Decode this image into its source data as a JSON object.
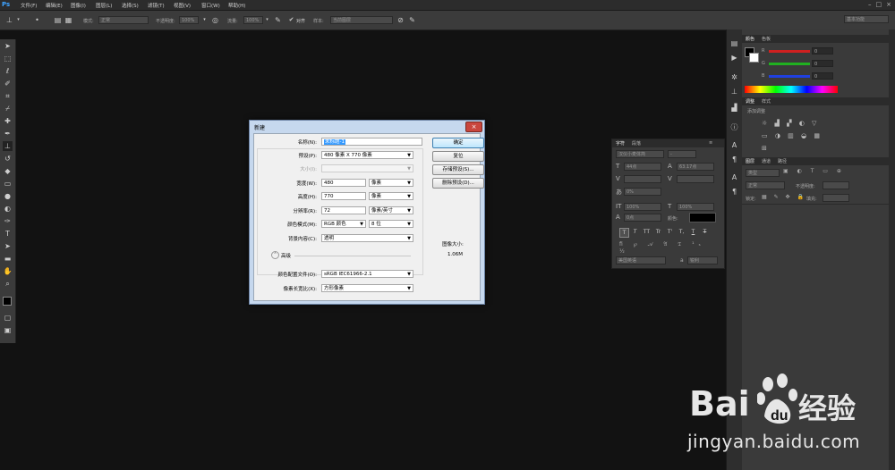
{
  "app": {
    "logo": "Ps"
  },
  "menu": [
    "文件(F)",
    "编辑(E)",
    "图像(I)",
    "图层(L)",
    "选择(S)",
    "滤镜(T)",
    "视图(V)",
    "窗口(W)",
    "帮助(H)"
  ],
  "options_bar": {
    "mode_label": "模式:",
    "mode_value": "正常",
    "opacity_label": "不透明度:",
    "opacity_value": "100%",
    "flow_label": "流量:",
    "flow_value": "100%",
    "aligned_label": "对齐",
    "sample_label": "样本:",
    "sample_value": "当前图层",
    "workspace": "基本功能"
  },
  "color_panel": {
    "tabs": [
      "颜色",
      "色板"
    ],
    "channels": [
      {
        "label": "R",
        "value": "0",
        "color": "#d02020"
      },
      {
        "label": "G",
        "value": "0",
        "color": "#20b020"
      },
      {
        "label": "B",
        "value": "0",
        "color": "#2040e0"
      }
    ]
  },
  "adjust_panel": {
    "tabs": [
      "调整",
      "样式"
    ],
    "hint": "添加调整"
  },
  "layers_panel": {
    "tabs": [
      "图层",
      "通道",
      "路径"
    ],
    "kind": "类型",
    "blend": "正常",
    "opacity_label": "不透明度:",
    "lock_label": "锁定:",
    "fill_label": "填充:"
  },
  "char_panel": {
    "tabs": [
      "字符",
      "段落"
    ],
    "font_family": "汉仪小麦体简",
    "font_size": "44点",
    "leading": "63.17点",
    "tracking": "0%",
    "scale_v": "100%",
    "scale_h": "100%",
    "baseline": "0点",
    "color_label": "颜色:",
    "language": "美国英语",
    "aa_label": "a",
    "aa_value": "锐利",
    "styles": [
      "T",
      "T",
      "TT",
      "Tr",
      "T'",
      "T,",
      "T",
      "T"
    ]
  },
  "dialog": {
    "title": "新建",
    "name_label": "名称(N):",
    "name_value": "未标题-1",
    "preset_label": "预设(P):",
    "preset_value": "480 像素 X 770 像素",
    "size_label": "大小(I):",
    "width_label": "宽度(W):",
    "width_value": "480",
    "width_unit": "像素",
    "height_label": "高度(H):",
    "height_value": "770",
    "height_unit": "像素",
    "res_label": "分辨率(R):",
    "res_value": "72",
    "res_unit": "像素/英寸",
    "color_mode_label": "颜色模式(M):",
    "color_mode_value": "RGB 颜色",
    "bit_depth": "8 位",
    "bg_label": "背景内容(C):",
    "bg_value": "透明",
    "advanced_label": "高级",
    "profile_label": "颜色配置文件(O):",
    "profile_value": "sRGB IEC61966-2.1",
    "aspect_label": "像素长宽比(X):",
    "aspect_value": "方形像素",
    "image_size_label": "图像大小:",
    "image_size_value": "1.06M",
    "buttons": {
      "ok": "确定",
      "reset": "复位",
      "save_preset": "存储预设(S)...",
      "delete_preset": "删除预设(D)..."
    }
  },
  "watermark": {
    "brand": "Bai",
    "brand_cn": "经验",
    "url": "jingyan.baidu.com"
  }
}
